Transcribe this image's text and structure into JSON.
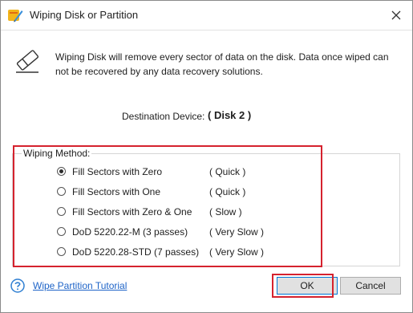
{
  "window": {
    "title": "Wiping Disk or Partition",
    "close_symbol": "✕"
  },
  "info": {
    "icon": "eraser-icon",
    "text": "Wiping Disk will remove every sector of data on the disk. Data once wiped can not be recovered by any data recovery solutions."
  },
  "destination": {
    "label": "Destination Device:",
    "value": "( Disk 2 )"
  },
  "wiping_method": {
    "title": "Wiping Method:",
    "selected_index": 0,
    "options": [
      {
        "label": "Fill Sectors with Zero",
        "speed": "( Quick )"
      },
      {
        "label": "Fill Sectors with One",
        "speed": "( Quick )"
      },
      {
        "label": "Fill Sectors with Zero & One",
        "speed": "( Slow )"
      },
      {
        "label": "DoD 5220.22-M (3 passes)",
        "speed": "( Very Slow )"
      },
      {
        "label": "DoD 5220.28-STD (7 passes)",
        "speed": "( Very Slow )"
      }
    ]
  },
  "footer": {
    "help_icon": "help-circle-icon",
    "tutorial_link": "Wipe Partition Tutorial",
    "ok_label": "OK",
    "cancel_label": "Cancel"
  },
  "colors": {
    "highlight": "#d5222e",
    "link": "#1e64c8",
    "button_bg": "#e1e1e1"
  }
}
